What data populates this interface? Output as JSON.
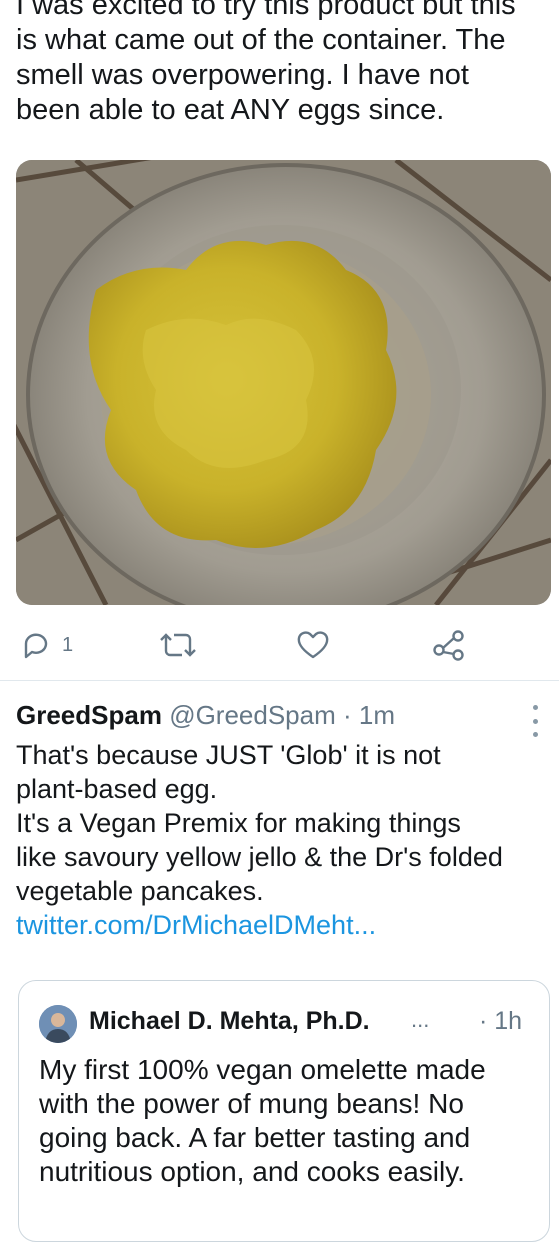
{
  "tweet": {
    "text_lines": [
      "I was excited to try this product but this",
      "is what came out of the container.  The",
      "smell was overpowering.  I have not",
      "been able to eat ANY eggs since."
    ],
    "reply_count": "1"
  },
  "actions": {
    "reply_icon": "reply-icon",
    "retweet_icon": "retweet-icon",
    "like_icon": "heart-icon",
    "share_icon": "share-icon"
  },
  "reply": {
    "name": "GreedSpam",
    "handle": "@GreedSpam",
    "time": "· 1m",
    "body_lines": [
      "That's because JUST 'Glob' it is not",
      "plant-based egg.",
      "It's a Vegan Premix for making things",
      "like savoury yellow jello & the Dr's folded",
      "vegetable pancakes."
    ],
    "link": "twitter.com/DrMichaelDMeht..."
  },
  "quoted": {
    "name": "Michael D. Mehta, Ph.D.",
    "ellipsis": "...",
    "time": "· 1h",
    "body_lines": [
      "My first 100% vegan omelette made",
      "with the power of mung beans! No",
      "going back. A far better tasting and",
      "nutritious option, and cooks easily."
    ]
  },
  "colors": {
    "text": "#14171a",
    "secondary": "#657786",
    "link": "#1b95e0",
    "border": "#ccd6dd"
  }
}
